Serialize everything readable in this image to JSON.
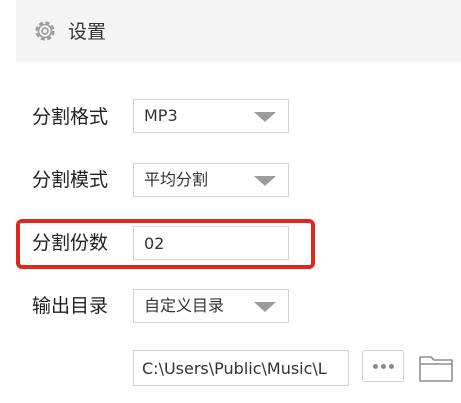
{
  "header": {
    "icon": "gear-icon",
    "title": "设置"
  },
  "format": {
    "label": "分割格式",
    "value": "MP3"
  },
  "mode": {
    "label": "分割模式",
    "value": "平均分割"
  },
  "parts": {
    "label": "分割份数",
    "value": "02"
  },
  "output": {
    "label": "输出目录",
    "value": "自定义目录",
    "path": "C:\\Users\\Public\\Music\\L",
    "more_icon": "more-dots-icon",
    "folder_icon": "folder-icon"
  },
  "colors": {
    "highlight": "#e1261c",
    "header_bg": "#f4f4f4",
    "arrow": "#9b9b9b"
  }
}
